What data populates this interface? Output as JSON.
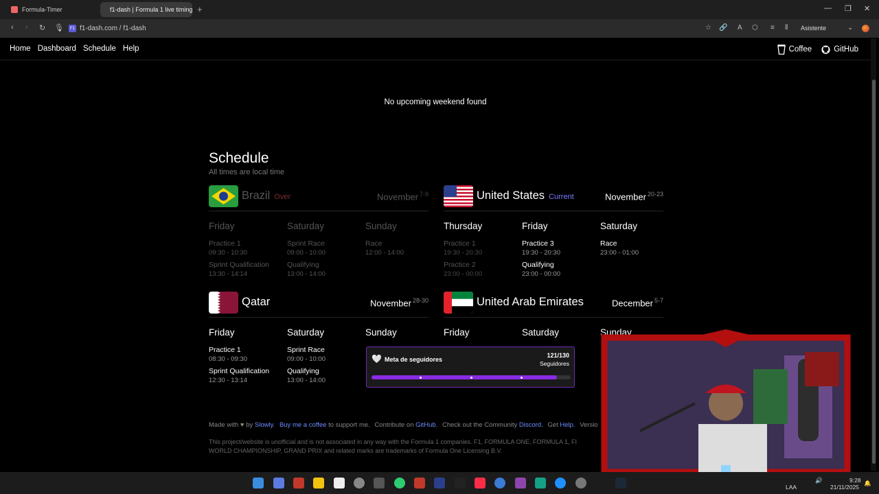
{
  "browser": {
    "tabs": [
      {
        "label": "Formula-Timer",
        "active": false
      },
      {
        "label": "f1-dash | Formula 1 live timing",
        "active": true
      }
    ],
    "url": "f1-dash.com / f1-dash",
    "assistant_label": "Asistente"
  },
  "site_nav": {
    "links": [
      "Home",
      "Dashboard",
      "Schedule",
      "Help"
    ],
    "coffee_label": "Coffee",
    "github_label": "GitHub"
  },
  "upcoming_message": "No upcoming weekend found",
  "schedule": {
    "title": "Schedule",
    "subtitle": "All times are local time",
    "weekends": [
      {
        "country": "Brazil",
        "status": "Over",
        "month": "November",
        "dates": "7-9",
        "days": [
          {
            "name": "Friday",
            "sessions": [
              {
                "name": "Practice 1",
                "time": "09:30 - 10:30"
              },
              {
                "name": "Sprint Qualification",
                "time": "13:30 - 14:14"
              }
            ]
          },
          {
            "name": "Saturday",
            "sessions": [
              {
                "name": "Sprint Race",
                "time": "09:00 - 10:00"
              },
              {
                "name": "Qualifying",
                "time": "13:00 - 14:00"
              }
            ]
          },
          {
            "name": "Sunday",
            "sessions": [
              {
                "name": "Race",
                "time": "12:00 - 14:00"
              }
            ]
          }
        ]
      },
      {
        "country": "United States",
        "status": "Current",
        "month": "November",
        "dates": "20-23",
        "days": [
          {
            "name": "Thursday",
            "sessions": [
              {
                "name": "Practice 1",
                "time": "19:30 - 20:30"
              },
              {
                "name": "Practice 2",
                "time": "23:00 - 00:00"
              }
            ]
          },
          {
            "name": "Friday",
            "sessions": [
              {
                "name": "Practice 3",
                "time": "19:30 - 20:30"
              },
              {
                "name": "Qualifying",
                "time": "23:00 - 00:00"
              }
            ]
          },
          {
            "name": "Saturday",
            "sessions": [
              {
                "name": "Race",
                "time": "23:00 - 01:00"
              }
            ]
          }
        ]
      },
      {
        "country": "Qatar",
        "status": "",
        "month": "November",
        "dates": "28-30",
        "days": [
          {
            "name": "Friday",
            "sessions": [
              {
                "name": "Practice 1",
                "time": "08:30 - 09:30"
              },
              {
                "name": "Sprint Qualification",
                "time": "12:30 - 13:14"
              }
            ]
          },
          {
            "name": "Saturday",
            "sessions": [
              {
                "name": "Sprint Race",
                "time": "09:00 - 10:00"
              },
              {
                "name": "Qualifying",
                "time": "13:00 - 14:00"
              }
            ]
          },
          {
            "name": "Sunday",
            "sessions": []
          }
        ]
      },
      {
        "country": "United Arab Emirates",
        "status": "",
        "month": "December",
        "dates": "5-7",
        "days": [
          {
            "name": "Friday",
            "sessions": []
          },
          {
            "name": "Saturday",
            "sessions": []
          },
          {
            "name": "Sunday",
            "sessions": []
          }
        ]
      }
    ]
  },
  "widget": {
    "title": "Meta de seguidores",
    "count": "121/130",
    "unit": "Seguidores",
    "progress": 0.93
  },
  "footer": {
    "made_with": "Made with ♥ by",
    "author": "Slowly.",
    "coffee_link": "Buy me a coffee",
    "support": "to support me.",
    "contribute": "Contribute on",
    "github": "GitHub.",
    "community": "Check out the Community",
    "discord": "Discord.",
    "get": "Get",
    "help": "Help.",
    "version": "Versio",
    "disclaimer": "This project/website is unofficial and is not associated in any way with the Formula 1 companies. F1, FORMULA ONE, FORMULA 1, FI WORLD CHAMPIONSHIP, GRAND PRIX and related marks are trademarks of Formula One Licensing B.V."
  },
  "taskbar": {
    "lang": "LAA",
    "time": "9:28",
    "date": "21/11/2025"
  }
}
